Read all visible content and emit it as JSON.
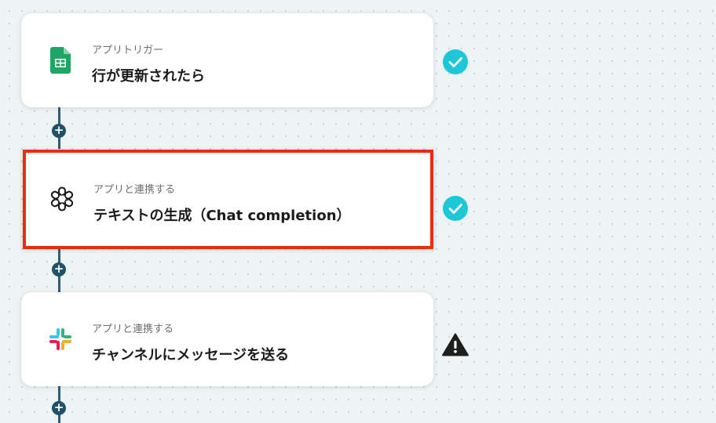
{
  "steps": [
    {
      "subtitle": "アプリトリガー",
      "title": "行が更新されたら",
      "app_icon": "google-sheets-icon",
      "status": "complete",
      "status_icon": "check-circle-icon"
    },
    {
      "subtitle": "アプリと連携する",
      "title": "テキストの生成（Chat completion）",
      "app_icon": "openai-icon",
      "status": "complete",
      "status_icon": "check-circle-icon",
      "selected": true
    },
    {
      "subtitle": "アプリと連携する",
      "title": "チャンネルにメッセージを送る",
      "app_icon": "slack-icon",
      "status": "warning",
      "status_icon": "warning-icon"
    }
  ],
  "add_step_symbol": "+",
  "colors": {
    "selected_border": "#ea2c10",
    "check": "#1dc7d8",
    "connector": "#2c5f73",
    "warning": "#1e1e1e"
  }
}
